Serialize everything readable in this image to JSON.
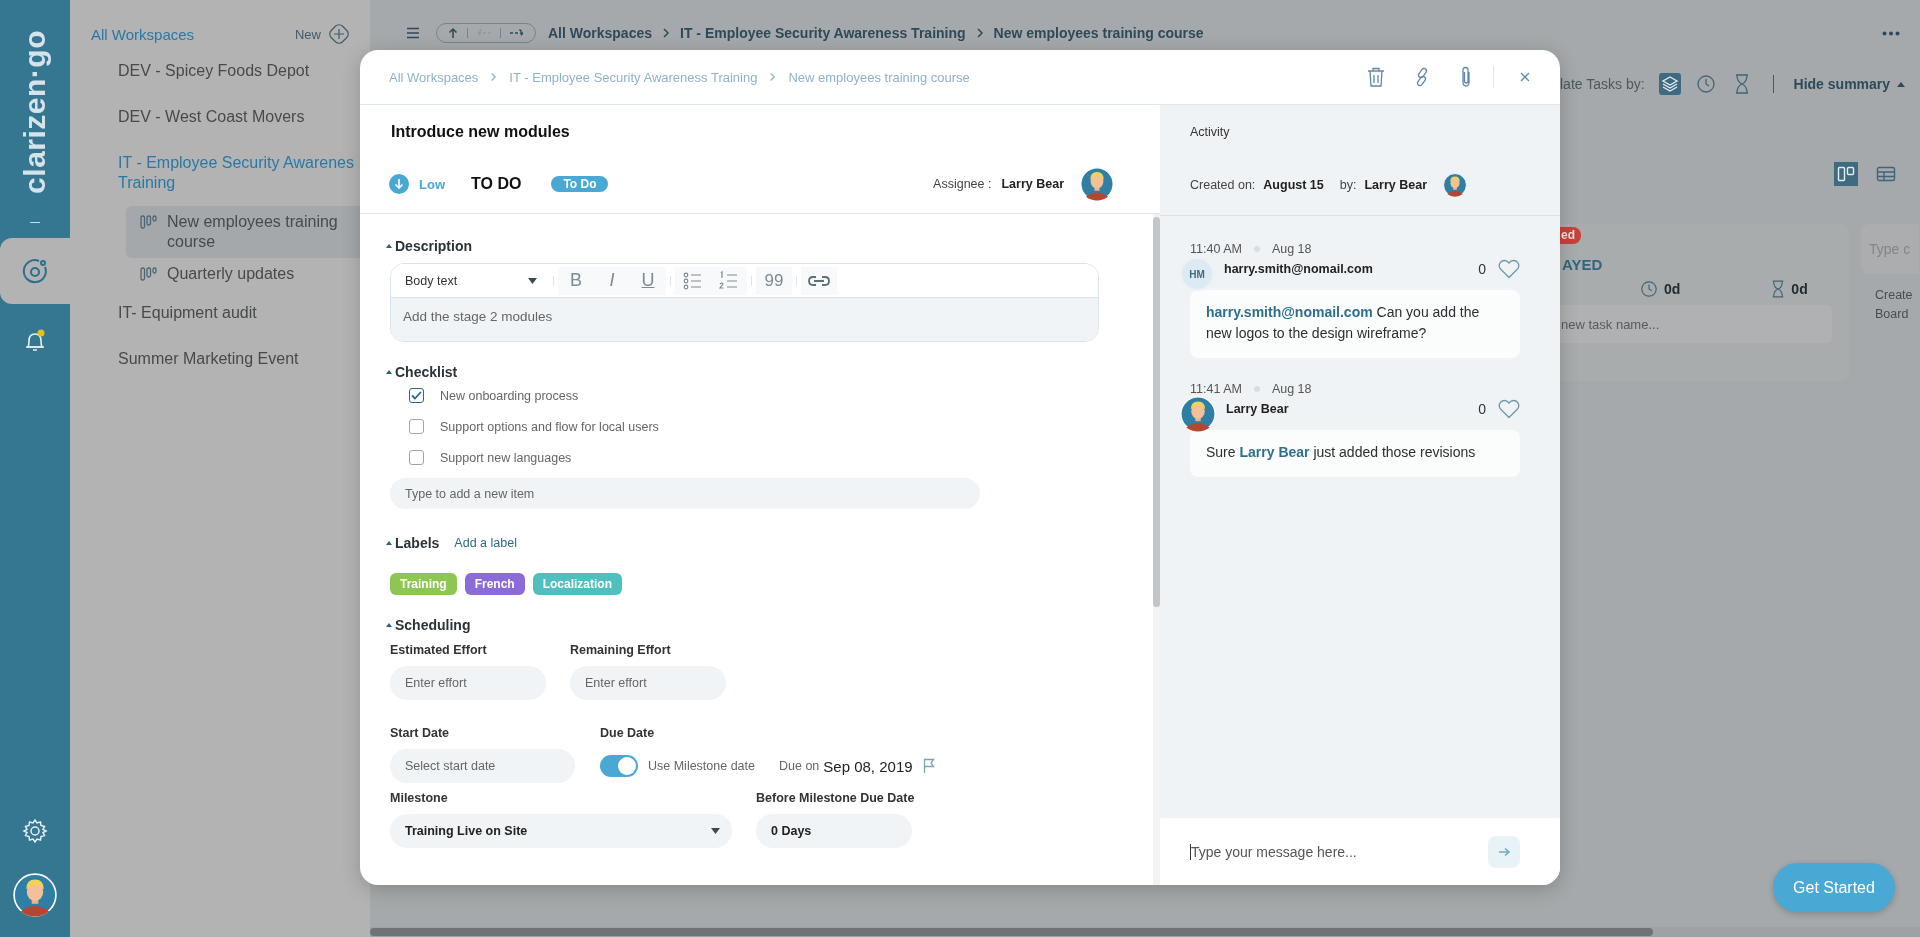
{
  "rail": {
    "logo": "clarizen·go",
    "items": [
      {
        "kind": "workspaces",
        "selected": true,
        "unread": false
      },
      {
        "kind": "notifications",
        "selected": false,
        "unread": true
      }
    ]
  },
  "sidebar": {
    "heading": "All Workspaces",
    "new_label": "New",
    "items": [
      {
        "lines": [
          "DEV - Spicey Foods Depot"
        ],
        "open": false
      },
      {
        "lines": [
          "DEV - West Coast Movers"
        ],
        "open": false
      },
      {
        "lines": [
          "IT - Employee Security Awarenes",
          "Training"
        ],
        "open": true,
        "children": [
          {
            "label": "New employees training course",
            "selected": true
          },
          {
            "label": "Quarterly updates",
            "selected": false
          }
        ]
      },
      {
        "lines": [
          "IT- Equipment audit"
        ],
        "open": false
      },
      {
        "lines": [
          "Summer Marketing Event"
        ],
        "open": false
      }
    ]
  },
  "topbar": {
    "back_enabled": false,
    "breadcrumbs": [
      "All Workspaces",
      "IT - Employee Security Awareness Training",
      "New employees training course"
    ]
  },
  "summary_bar": {
    "label": "late Tasks by:",
    "modes": [
      {
        "kind": "layers",
        "selected": true
      },
      {
        "kind": "clock",
        "selected": false
      },
      {
        "kind": "hourglass",
        "selected": false
      }
    ],
    "toggle_label": "Hide summary"
  },
  "views": [
    {
      "kind": "board",
      "selected": true
    },
    {
      "kind": "table",
      "selected": false
    }
  ],
  "board": {
    "column": {
      "badge": "ed",
      "title": "AYED",
      "effort": "0d",
      "remaining": "0d",
      "placeholder": "new task name..."
    },
    "next_column": {
      "placeholder": "Type c",
      "hint_lines": [
        "Create",
        "Board"
      ]
    }
  },
  "get_started": "Get Started",
  "task": {
    "breadcrumbs": [
      "All Workspaces",
      "IT - Employee Security Awareness Training",
      "New employees training course"
    ],
    "title": "Introduce new modules",
    "priority": "Low",
    "status": "TO DO",
    "stage": "To Do",
    "assignee_label": "Assignee :",
    "assignee": "Larry Bear",
    "description": {
      "heading": "Description",
      "style": "Body text",
      "toolbar": [
        {
          "kind": "glyph",
          "glyph": "B"
        },
        {
          "kind": "glyph",
          "glyph": "I"
        },
        {
          "kind": "glyph",
          "glyph": "U"
        },
        {
          "kind": "bullets"
        },
        {
          "kind": "numbers"
        },
        {
          "kind": "glyph",
          "glyph": "99"
        },
        {
          "kind": "link"
        }
      ],
      "text": "Add the stage 2 modules"
    },
    "checklist": {
      "heading": "Checklist",
      "items": [
        {
          "label": "New onboarding process",
          "checked": true
        },
        {
          "label": "Support options and flow for local users",
          "checked": false
        },
        {
          "label": "Support new languages",
          "checked": false
        }
      ],
      "placeholder": "Type to add a new item"
    },
    "labels": {
      "heading": "Labels",
      "add": "Add a label",
      "items": [
        {
          "label": "Training",
          "color": "#8dc653"
        },
        {
          "label": "French",
          "color": "#8a6bd8"
        },
        {
          "label": "Localization",
          "color": "#4fc0bd"
        }
      ]
    },
    "scheduling": {
      "heading": "Scheduling",
      "estimated_label": "Estimated Effort",
      "estimated_placeholder": "Enter effort",
      "remaining_label": "Remaining Effort",
      "remaining_placeholder": "Enter effort",
      "start_label": "Start Date",
      "start_placeholder": "Select start date",
      "due_label": "Due Date",
      "use_milestone_label": "Use Milestone date",
      "use_milestone_on": true,
      "due_prefix": "Due on",
      "due_date": "Sep 08, 2019",
      "milestone_label": "Milestone",
      "milestone_value": "Training Live on Site",
      "before_label": "Before Milestone Due Date",
      "before_value": "0 Days"
    }
  },
  "activity": {
    "heading": "Activity",
    "created_label": "Created on:",
    "created_date": "August 15",
    "by_label": "by:",
    "by": "Larry Bear",
    "messages": [
      {
        "time": "11:40 AM",
        "date": "Aug 18",
        "author": "harry.smith@nomail.com",
        "avatar": {
          "kind": "initials",
          "initials": "HM"
        },
        "likes": "0",
        "parts": [
          {
            "kind": "mention",
            "text": "harry.smith@nomail.com"
          },
          {
            "kind": "plain",
            "text": " Can you add the new logos to the design wireframe?"
          }
        ]
      },
      {
        "time": "11:41 AM",
        "date": "Aug 18",
        "author": "Larry Bear",
        "avatar": {
          "kind": "person"
        },
        "likes": "0",
        "parts": [
          {
            "kind": "plain",
            "text": "Sure "
          },
          {
            "kind": "mention",
            "text": "Larry Bear"
          },
          {
            "kind": "plain",
            "text": " just added those revisions"
          }
        ]
      }
    ],
    "input_placeholder": "Type your message here..."
  }
}
